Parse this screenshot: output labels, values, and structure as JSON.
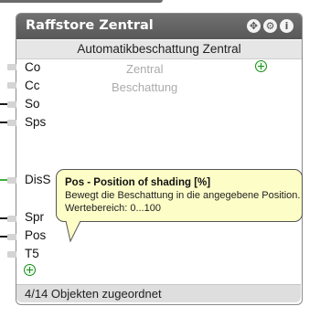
{
  "block": {
    "title": "Raffstore Zentral",
    "subheader": "Automatikbeschattung Zentral",
    "watermark": [
      "Zentral",
      "Beschattung"
    ],
    "buttons": {
      "move": "✥",
      "settings": "⚙",
      "info": "i"
    },
    "inputs": [
      "Co",
      "Cc",
      "So",
      "Sps",
      "DisS",
      "Spr",
      "Pos",
      "T5"
    ],
    "footer": "4/14 Objekten zugeordnet"
  },
  "tooltip": {
    "title": "Pos - Position of shading [%]",
    "line1": "Bewegt die Beschattung in die angegebene Position.",
    "line2": "Wertebereich: 0...100"
  },
  "colors": {
    "titlebar": "#646464",
    "tooltip_bg": "#fdfdc8",
    "add_green": "#1d8a1d",
    "active_input_line": "#3cb03c"
  }
}
